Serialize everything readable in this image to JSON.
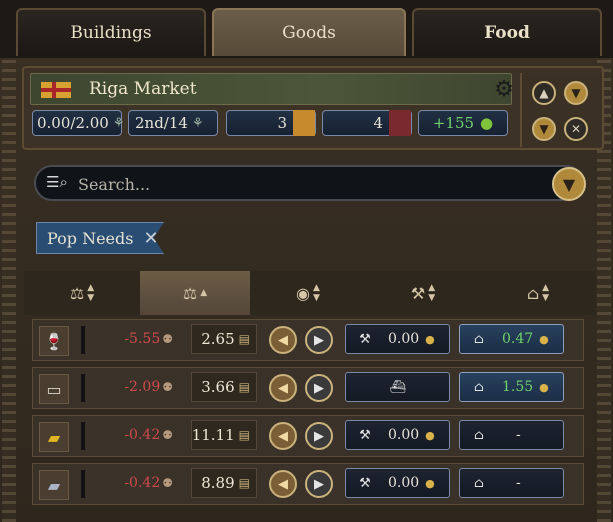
{
  "tabs": [
    {
      "label": "Buildings"
    },
    {
      "label": "Goods"
    },
    {
      "label": "Food"
    }
  ],
  "market": {
    "name": "Riga Market",
    "stats": {
      "capacity": "0.00/2.00",
      "rank": "2nd/14",
      "count_a": "3",
      "count_b": "4",
      "balance": "+155"
    }
  },
  "search": {
    "placeholder": "Search..."
  },
  "filter_chip": {
    "label": "Pop Needs",
    "close": "✕"
  },
  "header_icons": [
    "sort-name-icon",
    "scale-icon",
    "coins-icon",
    "production-icon",
    "consumption-icon"
  ],
  "rows": [
    {
      "good": "wine-icon",
      "change": "-5.55",
      "price": "2.65",
      "produce": "0.00",
      "consume": "0.47",
      "consume_active": true,
      "consume_green": true,
      "produce_ship": false
    },
    {
      "good": "cloth-icon",
      "change": "-2.09",
      "price": "3.66",
      "produce": "",
      "consume": "1.55",
      "consume_active": true,
      "consume_green": true,
      "produce_ship": true
    },
    {
      "good": "gold-icon",
      "change": "-0.42",
      "price": "11.11",
      "produce": "0.00",
      "consume": "-",
      "consume_active": false,
      "consume_green": false,
      "produce_ship": false
    },
    {
      "good": "silver-icon",
      "change": "-0.42",
      "price": "8.89",
      "produce": "0.00",
      "consume": "-",
      "consume_active": false,
      "consume_green": false,
      "produce_ship": false
    }
  ],
  "colors": {
    "accent_gold": "#b08a3a",
    "negative": "#d04a4a",
    "positive": "#6fd06b"
  }
}
